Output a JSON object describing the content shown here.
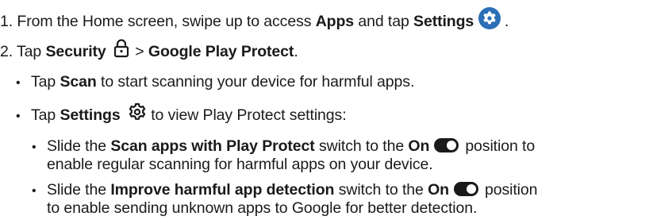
{
  "step1": {
    "prefix": "1. From the Home screen, swipe up to access ",
    "apps": "Apps",
    "and_tap": " and tap ",
    "settings": "Settings",
    "icon": "settings-gear-circle-icon",
    "end": " ."
  },
  "step2": {
    "prefix": "2. Tap ",
    "security": "Security",
    "icon": "lock-icon",
    "arrow": " > ",
    "gpp": "Google Play Protect",
    "end": "."
  },
  "bullet_scan": {
    "tap": "Tap ",
    "scan": "Scan",
    "rest": " to start scanning your device for harmful apps."
  },
  "bullet_settings": {
    "tap": "Tap ",
    "settings": "Settings",
    "icon": "gear-icon",
    "rest": " to view Play Protect settings:"
  },
  "sub1": {
    "slide": "Slide the ",
    "name": "Scan apps with Play Protect",
    "switch_to": " switch to the ",
    "on": "On",
    "position": "position to",
    "line2": "enable regular scanning for harmful apps on your device.",
    "toggle_icon": "toggle-on-icon"
  },
  "sub2": {
    "slide": "Slide the ",
    "name": "Improve harmful app detection",
    "switch_to": " switch to the ",
    "on": "On",
    "position": "position",
    "line2": "to enable sending unknown apps to Google for better detection.",
    "toggle_icon": "toggle-on-icon"
  },
  "bullet_glyph": "•"
}
